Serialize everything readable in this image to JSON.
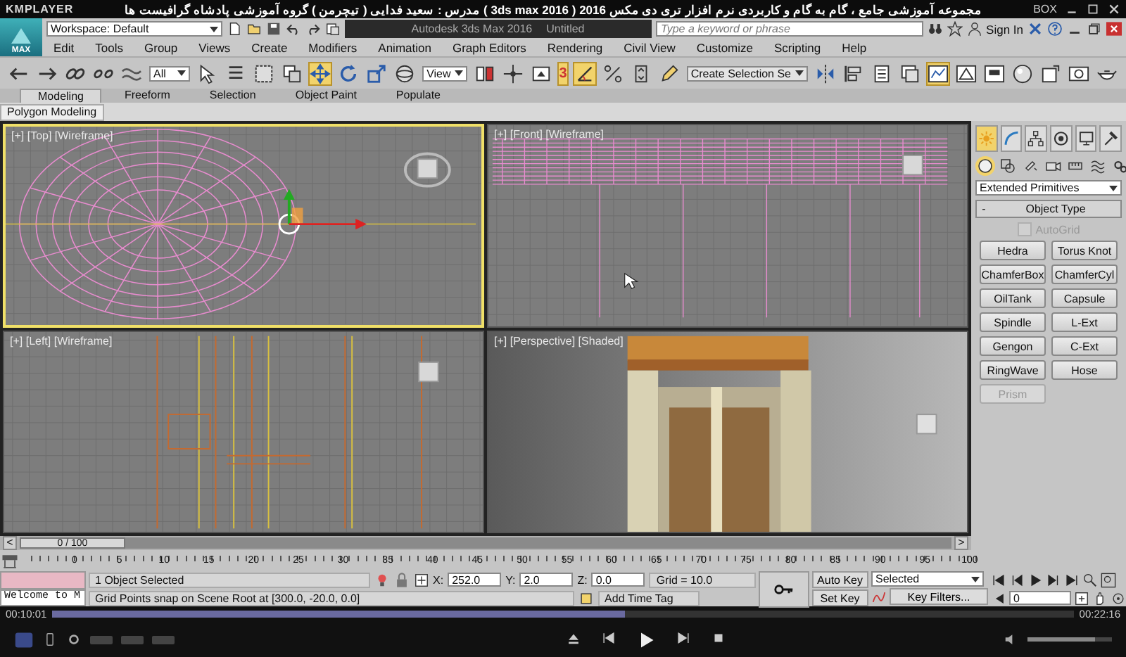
{
  "player": {
    "brand": "KMPLAYER",
    "title": "مجموعه آموزشی جامع ، گام به گام و کاربردی نرم افزار تری دی مکس 2016 ( 3ds max 2016 ) مدرس : سعید فدایی ( تیچرمن ) گروه آموزشی پادشاه گرافیست ها",
    "box": "BOX"
  },
  "max": {
    "logo": "MAX",
    "workspace": "Workspace: Default",
    "title": "Autodesk 3ds Max 2016",
    "file": "Untitled",
    "search_placeholder": "Type a keyword or phrase",
    "sign_in": "Sign In"
  },
  "menu": [
    "Edit",
    "Tools",
    "Group",
    "Views",
    "Create",
    "Modifiers",
    "Animation",
    "Graph Editors",
    "Rendering",
    "Civil View",
    "Customize",
    "Scripting",
    "Help"
  ],
  "toolbar": {
    "selection_filter": "All",
    "tools": [
      {
        "selected": false
      },
      {
        "selected": false
      },
      {
        "selected": false
      },
      {
        "selected": false
      },
      {
        "selected": true
      },
      {
        "selected": false
      },
      {
        "selected": false
      }
    ],
    "reference_coord": "View",
    "snaps": [
      {
        "label": "3",
        "on": true
      },
      {
        "on": true
      },
      {
        "on": false
      },
      {
        "on": false
      }
    ],
    "named_selection": "Create Selection Se"
  },
  "ribbon": {
    "tabs": [
      {
        "label": "Modeling",
        "selected": true
      },
      {
        "label": "Freeform",
        "selected": false
      },
      {
        "label": "Selection",
        "selected": false
      },
      {
        "label": "Object Paint",
        "selected": false
      },
      {
        "label": "Populate",
        "selected": false
      }
    ],
    "panel": "Polygon Modeling"
  },
  "viewports": [
    {
      "kind": "top",
      "label": "[+] [Top] [Wireframe]",
      "selected": true
    },
    {
      "kind": "front",
      "label": "[+] [Front] [Wireframe]",
      "selected": false
    },
    {
      "kind": "left",
      "label": "[+] [Left] [Wireframe]",
      "selected": false
    },
    {
      "kind": "perspective",
      "label": "[+] [Perspective] [Shaded]",
      "selected": false
    }
  ],
  "command_panel": {
    "tabs": [
      {
        "selected": true
      },
      {
        "selected": false
      },
      {
        "selected": false
      },
      {
        "selected": false
      },
      {
        "selected": false
      },
      {
        "selected": false
      }
    ],
    "categories": [
      {
        "selected": true
      },
      {
        "selected": false
      },
      {
        "selected": false
      },
      {
        "selected": false
      },
      {
        "selected": false
      },
      {
        "selected": false
      },
      {
        "selected": false
      }
    ],
    "object_class": "Extended Primitives",
    "rollout_toggle": "-",
    "rollout": "Object Type",
    "autogrid": {
      "label": "AutoGrid",
      "checked": false,
      "disabled": true
    },
    "buttons": [
      {
        "label": "Hedra",
        "disabled": false
      },
      {
        "label": "Torus Knot",
        "disabled": false
      },
      {
        "label": "ChamferBox",
        "disabled": false
      },
      {
        "label": "ChamferCyl",
        "disabled": false
      },
      {
        "label": "OilTank",
        "disabled": false
      },
      {
        "label": "Capsule",
        "disabled": false
      },
      {
        "label": "Spindle",
        "disabled": false
      },
      {
        "label": "L-Ext",
        "disabled": false
      },
      {
        "label": "Gengon",
        "disabled": false
      },
      {
        "label": "C-Ext",
        "disabled": false
      },
      {
        "label": "RingWave",
        "disabled": false
      },
      {
        "label": "Hose",
        "disabled": false
      },
      {
        "label": "Prism",
        "disabled": true
      }
    ]
  },
  "time_slider": {
    "prev": "<",
    "frame": "0 / 100",
    "next": ">",
    "level": 0
  },
  "trackbar": {
    "ticks": [
      "0",
      "5",
      "10",
      "15",
      "20",
      "25",
      "30",
      "35",
      "40",
      "45",
      "50",
      "55",
      "60",
      "65",
      "70",
      "75",
      "80",
      "85",
      "90",
      "95",
      "100"
    ]
  },
  "status": {
    "listener_output": "Welcome to M",
    "selection": "1 Object Selected",
    "prompt": "Grid Points snap on Scene Root at [300.0, -20.0, 0.0]",
    "coords": [
      {
        "label": "X:",
        "value": "252.0"
      },
      {
        "label": "Y:",
        "value": "2.0"
      },
      {
        "label": "Z:",
        "value": "0.0"
      }
    ],
    "grid": "Grid = 10.0",
    "time_tag": "Add Time Tag"
  },
  "animation": {
    "auto_key": {
      "label": "Auto Key",
      "on": false
    },
    "set_key": "Set Key",
    "key_mode": "Selected",
    "key_filters": "Key Filters...",
    "frame": "0"
  },
  "playback": {
    "elapsed": "00:10:01",
    "total": "00:22:16",
    "level": 0.56,
    "volume": {
      "level": 0.8
    }
  }
}
